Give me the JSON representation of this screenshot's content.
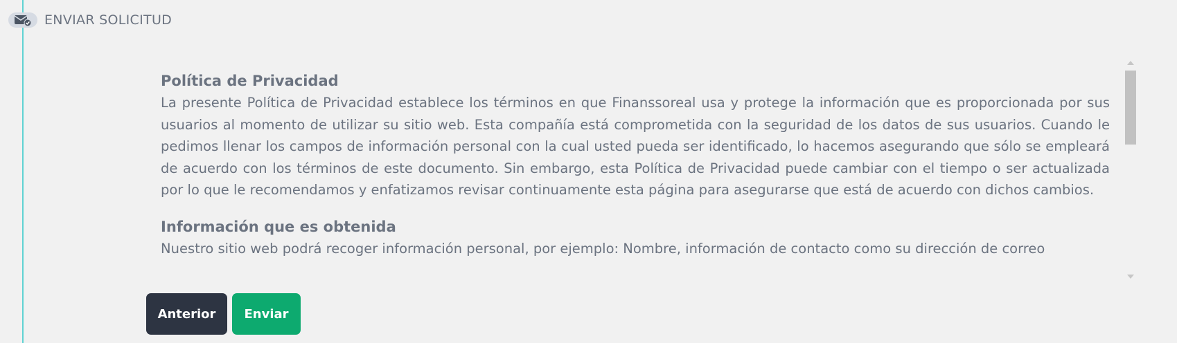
{
  "step": {
    "icon": "envelope-check-icon",
    "title": "ENVIAR SOLICITUD"
  },
  "policy": {
    "sections": [
      {
        "heading": "Política de Privacidad",
        "body": "La presente Política de Privacidad establece los términos en que Finanssoreal usa y protege la información que es proporcionada por sus usuarios al momento de utilizar su sitio web. Esta compañía está comprometida con la seguridad de los datos de sus usuarios. Cuando le pedimos llenar los campos de información personal con la cual usted pueda ser identificado, lo hacemos asegurando que sólo se empleará de acuerdo con los términos de este documento. Sin embargo, esta Política de Privacidad puede cambiar con el tiempo o ser actualizada por lo que le recomendamos y enfatizamos revisar continuamente esta página para asegurarse que está de acuerdo con dichos cambios."
      },
      {
        "heading": "Información que es obtenida",
        "body": "Nuestro sitio web podrá recoger información personal, por ejemplo: Nombre, información de contacto como su dirección de correo"
      }
    ]
  },
  "buttons": {
    "prev_label": "Anterior",
    "next_label": "Enviar"
  },
  "colors": {
    "timeline": "#5fd3d3",
    "prev_button": "#2d3442",
    "next_button": "#0daa6f",
    "text": "#6b7380"
  }
}
